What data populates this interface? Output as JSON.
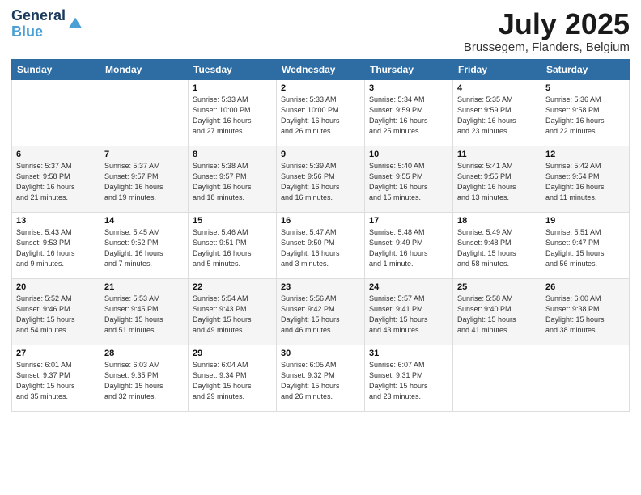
{
  "logo": {
    "line1": "General",
    "line2": "Blue"
  },
  "title": "July 2025",
  "subtitle": "Brussegem, Flanders, Belgium",
  "weekdays": [
    "Sunday",
    "Monday",
    "Tuesday",
    "Wednesday",
    "Thursday",
    "Friday",
    "Saturday"
  ],
  "weeks": [
    [
      {
        "day": "",
        "info": ""
      },
      {
        "day": "",
        "info": ""
      },
      {
        "day": "1",
        "info": "Sunrise: 5:33 AM\nSunset: 10:00 PM\nDaylight: 16 hours\nand 27 minutes."
      },
      {
        "day": "2",
        "info": "Sunrise: 5:33 AM\nSunset: 10:00 PM\nDaylight: 16 hours\nand 26 minutes."
      },
      {
        "day": "3",
        "info": "Sunrise: 5:34 AM\nSunset: 9:59 PM\nDaylight: 16 hours\nand 25 minutes."
      },
      {
        "day": "4",
        "info": "Sunrise: 5:35 AM\nSunset: 9:59 PM\nDaylight: 16 hours\nand 23 minutes."
      },
      {
        "day": "5",
        "info": "Sunrise: 5:36 AM\nSunset: 9:58 PM\nDaylight: 16 hours\nand 22 minutes."
      }
    ],
    [
      {
        "day": "6",
        "info": "Sunrise: 5:37 AM\nSunset: 9:58 PM\nDaylight: 16 hours\nand 21 minutes."
      },
      {
        "day": "7",
        "info": "Sunrise: 5:37 AM\nSunset: 9:57 PM\nDaylight: 16 hours\nand 19 minutes."
      },
      {
        "day": "8",
        "info": "Sunrise: 5:38 AM\nSunset: 9:57 PM\nDaylight: 16 hours\nand 18 minutes."
      },
      {
        "day": "9",
        "info": "Sunrise: 5:39 AM\nSunset: 9:56 PM\nDaylight: 16 hours\nand 16 minutes."
      },
      {
        "day": "10",
        "info": "Sunrise: 5:40 AM\nSunset: 9:55 PM\nDaylight: 16 hours\nand 15 minutes."
      },
      {
        "day": "11",
        "info": "Sunrise: 5:41 AM\nSunset: 9:55 PM\nDaylight: 16 hours\nand 13 minutes."
      },
      {
        "day": "12",
        "info": "Sunrise: 5:42 AM\nSunset: 9:54 PM\nDaylight: 16 hours\nand 11 minutes."
      }
    ],
    [
      {
        "day": "13",
        "info": "Sunrise: 5:43 AM\nSunset: 9:53 PM\nDaylight: 16 hours\nand 9 minutes."
      },
      {
        "day": "14",
        "info": "Sunrise: 5:45 AM\nSunset: 9:52 PM\nDaylight: 16 hours\nand 7 minutes."
      },
      {
        "day": "15",
        "info": "Sunrise: 5:46 AM\nSunset: 9:51 PM\nDaylight: 16 hours\nand 5 minutes."
      },
      {
        "day": "16",
        "info": "Sunrise: 5:47 AM\nSunset: 9:50 PM\nDaylight: 16 hours\nand 3 minutes."
      },
      {
        "day": "17",
        "info": "Sunrise: 5:48 AM\nSunset: 9:49 PM\nDaylight: 16 hours\nand 1 minute."
      },
      {
        "day": "18",
        "info": "Sunrise: 5:49 AM\nSunset: 9:48 PM\nDaylight: 15 hours\nand 58 minutes."
      },
      {
        "day": "19",
        "info": "Sunrise: 5:51 AM\nSunset: 9:47 PM\nDaylight: 15 hours\nand 56 minutes."
      }
    ],
    [
      {
        "day": "20",
        "info": "Sunrise: 5:52 AM\nSunset: 9:46 PM\nDaylight: 15 hours\nand 54 minutes."
      },
      {
        "day": "21",
        "info": "Sunrise: 5:53 AM\nSunset: 9:45 PM\nDaylight: 15 hours\nand 51 minutes."
      },
      {
        "day": "22",
        "info": "Sunrise: 5:54 AM\nSunset: 9:43 PM\nDaylight: 15 hours\nand 49 minutes."
      },
      {
        "day": "23",
        "info": "Sunrise: 5:56 AM\nSunset: 9:42 PM\nDaylight: 15 hours\nand 46 minutes."
      },
      {
        "day": "24",
        "info": "Sunrise: 5:57 AM\nSunset: 9:41 PM\nDaylight: 15 hours\nand 43 minutes."
      },
      {
        "day": "25",
        "info": "Sunrise: 5:58 AM\nSunset: 9:40 PM\nDaylight: 15 hours\nand 41 minutes."
      },
      {
        "day": "26",
        "info": "Sunrise: 6:00 AM\nSunset: 9:38 PM\nDaylight: 15 hours\nand 38 minutes."
      }
    ],
    [
      {
        "day": "27",
        "info": "Sunrise: 6:01 AM\nSunset: 9:37 PM\nDaylight: 15 hours\nand 35 minutes."
      },
      {
        "day": "28",
        "info": "Sunrise: 6:03 AM\nSunset: 9:35 PM\nDaylight: 15 hours\nand 32 minutes."
      },
      {
        "day": "29",
        "info": "Sunrise: 6:04 AM\nSunset: 9:34 PM\nDaylight: 15 hours\nand 29 minutes."
      },
      {
        "day": "30",
        "info": "Sunrise: 6:05 AM\nSunset: 9:32 PM\nDaylight: 15 hours\nand 26 minutes."
      },
      {
        "day": "31",
        "info": "Sunrise: 6:07 AM\nSunset: 9:31 PM\nDaylight: 15 hours\nand 23 minutes."
      },
      {
        "day": "",
        "info": ""
      },
      {
        "day": "",
        "info": ""
      }
    ]
  ]
}
